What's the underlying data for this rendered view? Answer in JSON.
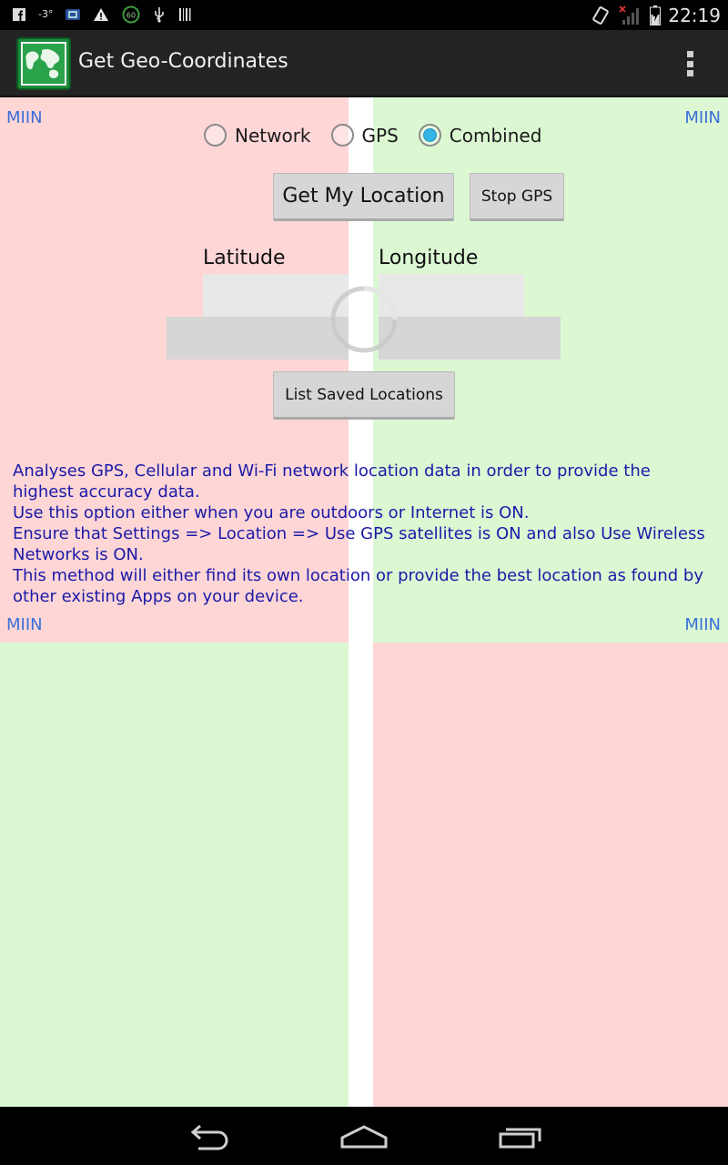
{
  "status_bar": {
    "time": "22:19",
    "left_icons": [
      "facebook-icon",
      "temperature-icon",
      "notification-icon",
      "warning-icon",
      "speed-60-icon",
      "usb-icon",
      "barcode-icon"
    ],
    "temperature": "-3°",
    "speed": "60"
  },
  "action_bar": {
    "title": "Get Geo-Coordinates",
    "app_icon": "world-map-icon"
  },
  "corner_labels": {
    "top_left": "MIIN",
    "top_right": "MIIN",
    "bottom_left": "MIIN",
    "bottom_right": "MIIN"
  },
  "mode_options": {
    "selected": "Combined",
    "items": [
      {
        "label": "Network",
        "checked": false
      },
      {
        "label": "GPS",
        "checked": false
      },
      {
        "label": "Combined",
        "checked": true
      }
    ]
  },
  "buttons": {
    "get_location": "Get My Location",
    "stop_gps": "Stop GPS",
    "list_saved": "List Saved Locations"
  },
  "fields": {
    "latitude_label": "Latitude",
    "longitude_label": "Longitude",
    "latitude_value": "",
    "longitude_value": ""
  },
  "description": [
    "Analyses GPS, Cellular and Wi-Fi network location data in order to provide the highest accuracy data.",
    "Use this option either when you are outdoors or Internet is ON.",
    "Ensure that Settings => Location => Use GPS satellites is ON and also Use Wireless Networks is ON.",
    "This method will either find its own location or provide the best location as found by other existing Apps on your device."
  ],
  "colors": {
    "pink_zone": "#ffd6d6",
    "green_zone": "#dbf8d3",
    "radio_accent": "#33b5e5",
    "miin_text": "#3a6fd8",
    "description_text": "#1a1aa8",
    "action_bar": "#232323"
  },
  "nav_bar": {
    "icons": [
      "back-icon",
      "home-icon",
      "recent-apps-icon"
    ]
  }
}
